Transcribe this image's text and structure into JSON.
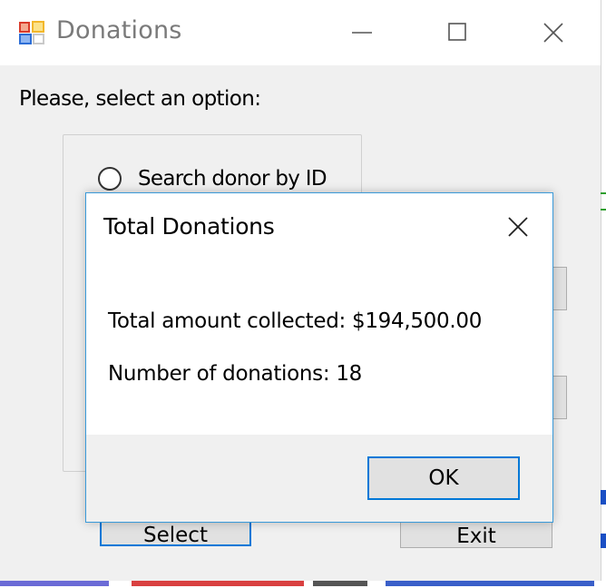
{
  "window": {
    "title": "Donations",
    "icon": "form-app-icon",
    "controls": [
      "minimize-icon",
      "maximize-icon",
      "close-icon"
    ]
  },
  "main": {
    "prompt": "Please, select an option:",
    "radio_option_label": "Search donor by ID",
    "select_button": "Select",
    "exit_button": "Exit"
  },
  "dialog": {
    "title": "Total Donations",
    "total_line": "Total amount collected: $194,500.00",
    "count_line": "Number of donations: 18",
    "ok_button": "OK"
  },
  "colors": {
    "accent_blue": "#0078d7",
    "dialog_border": "#3a9ad9",
    "window_bg": "#f0f0f0",
    "button_bg": "#e1e1e1"
  }
}
